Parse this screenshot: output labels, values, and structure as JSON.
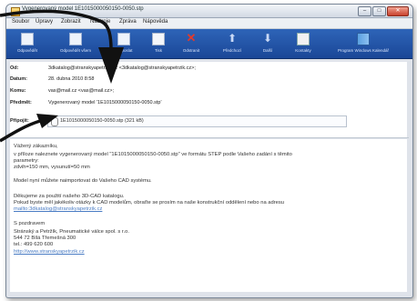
{
  "window": {
    "title": "Vygenerovaný model 1E1015000050150-0050.stp",
    "min_glyph": "–",
    "max_glyph": "□",
    "close_glyph": "✕"
  },
  "menu": [
    "Soubor",
    "Úpravy",
    "Zobrazit",
    "Nástroje",
    "Zpráva",
    "Nápověda"
  ],
  "toolbar": [
    {
      "label": "Odpovědět",
      "icon": "reply-icon"
    },
    {
      "label": "Odpovědět všem",
      "icon": "reply-all-icon"
    },
    {
      "label": "Přeposlat",
      "icon": "forward-icon"
    },
    {
      "label": "Tisk",
      "icon": "print-icon"
    },
    {
      "label": "Odstranit",
      "icon": "delete-icon"
    },
    {
      "label": "Předchozí",
      "icon": "previous-icon"
    },
    {
      "label": "Další",
      "icon": "next-icon"
    },
    {
      "label": "Kontakty",
      "icon": "contacts-icon"
    },
    {
      "label": "Program Windows Kalendář",
      "icon": "calendar-icon"
    }
  ],
  "header": {
    "from_label": "Od:",
    "from_value": "3dkatalog@stranskyapetrzik.cz <3dkatalog@stranskyapetrzik.cz>;",
    "date_label": "Datum:",
    "date_value": "28. dubna 2010 8:58",
    "to_label": "Komu:",
    "to_value": "vas@mail.cz <vas@mail.cz>;",
    "subject_label": "Předmět:",
    "subject_value": "Vygenerovaný model '1E1015000050150-0050.stp'",
    "attach_label": "Připojit:",
    "attach_value": "1E1015000050150-0050.stp (321 kB)"
  },
  "body": [
    {
      "text": "Vážený zákazníku,",
      "link": false
    },
    {
      "text": "v příloze naleznete vygenerovaný model \"1E1015000050150-0050.stp\" ve formátu STEP podle Vašeho zadání s těmito",
      "link": false
    },
    {
      "text": "parametry:",
      "link": false
    },
    {
      "text": "zdvih=150 mm, vysunutí=50 mm",
      "link": false
    },
    {
      "text": "",
      "link": false
    },
    {
      "text": "Model nyní můžete naimportovat do Vašeho CAD systému.",
      "link": false
    },
    {
      "text": "",
      "link": false
    },
    {
      "text": "Děkujeme za použití našeho 3D-CAD katalogu.",
      "link": false
    },
    {
      "text": "Pokud byste měl jakékoliv otázky k CAD modelům, obraťte se prosím na naše konstrukční oddělení nebo na adresu",
      "link": false
    },
    {
      "text": "mailto:3dkatalog@stranskyapetrzik.cz",
      "link": true
    },
    {
      "text": "",
      "link": false
    },
    {
      "text": "S pozdravem",
      "link": false
    },
    {
      "text": "Stránský a Petržík, Pneumatické válce spol. s r.o.",
      "link": false
    },
    {
      "text": "544 72 Bílá Třemešná 300",
      "link": false
    },
    {
      "text": "tel.: 499 620 600",
      "link": false
    },
    {
      "text": "http://www.stranskyapetrzik.cz",
      "link": true
    }
  ],
  "colors": {
    "toolbar": "#1f4e9e",
    "link": "#4a7cc4",
    "arrow": "#111111"
  }
}
